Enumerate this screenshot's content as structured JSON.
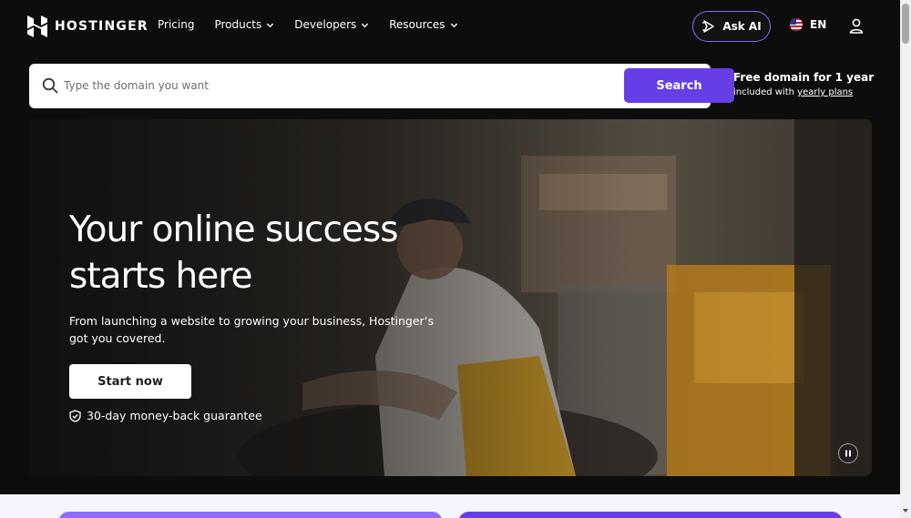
{
  "brand": {
    "name": "HOSTINGER",
    "logo_icon": "hostinger-h-logo"
  },
  "nav": {
    "items": [
      {
        "label": "Pricing",
        "has_dropdown": false
      },
      {
        "label": "Products",
        "has_dropdown": true
      },
      {
        "label": "Developers",
        "has_dropdown": true
      },
      {
        "label": "Resources",
        "has_dropdown": true
      }
    ]
  },
  "header": {
    "ask_ai_label": "Ask AI",
    "ask_ai_icon": "sparkle-arrow-icon",
    "language": "EN",
    "language_flag": "us-flag-icon",
    "account_icon": "user-icon"
  },
  "search": {
    "placeholder": "Type the domain you want",
    "value": "",
    "button_label": "Search"
  },
  "promo": {
    "title": "Free domain for 1 year",
    "subtitle_prefix": "included with ",
    "subtitle_link": "yearly plans"
  },
  "hero": {
    "title_line1": "Your online success",
    "title_line2": "starts here",
    "subtitle": "From launching a website to growing your business, Hostinger’s got you covered.",
    "cta_label": "Start now",
    "guarantee": "30-day money-back guarantee",
    "guarantee_icon": "shield-check-icon",
    "pause_icon": "pause-icon"
  },
  "colors": {
    "accent": "#673de6",
    "accent_light": "#8c6bff",
    "page_bg": "#0d0d0d",
    "lower_bg": "#f4f5ff"
  }
}
